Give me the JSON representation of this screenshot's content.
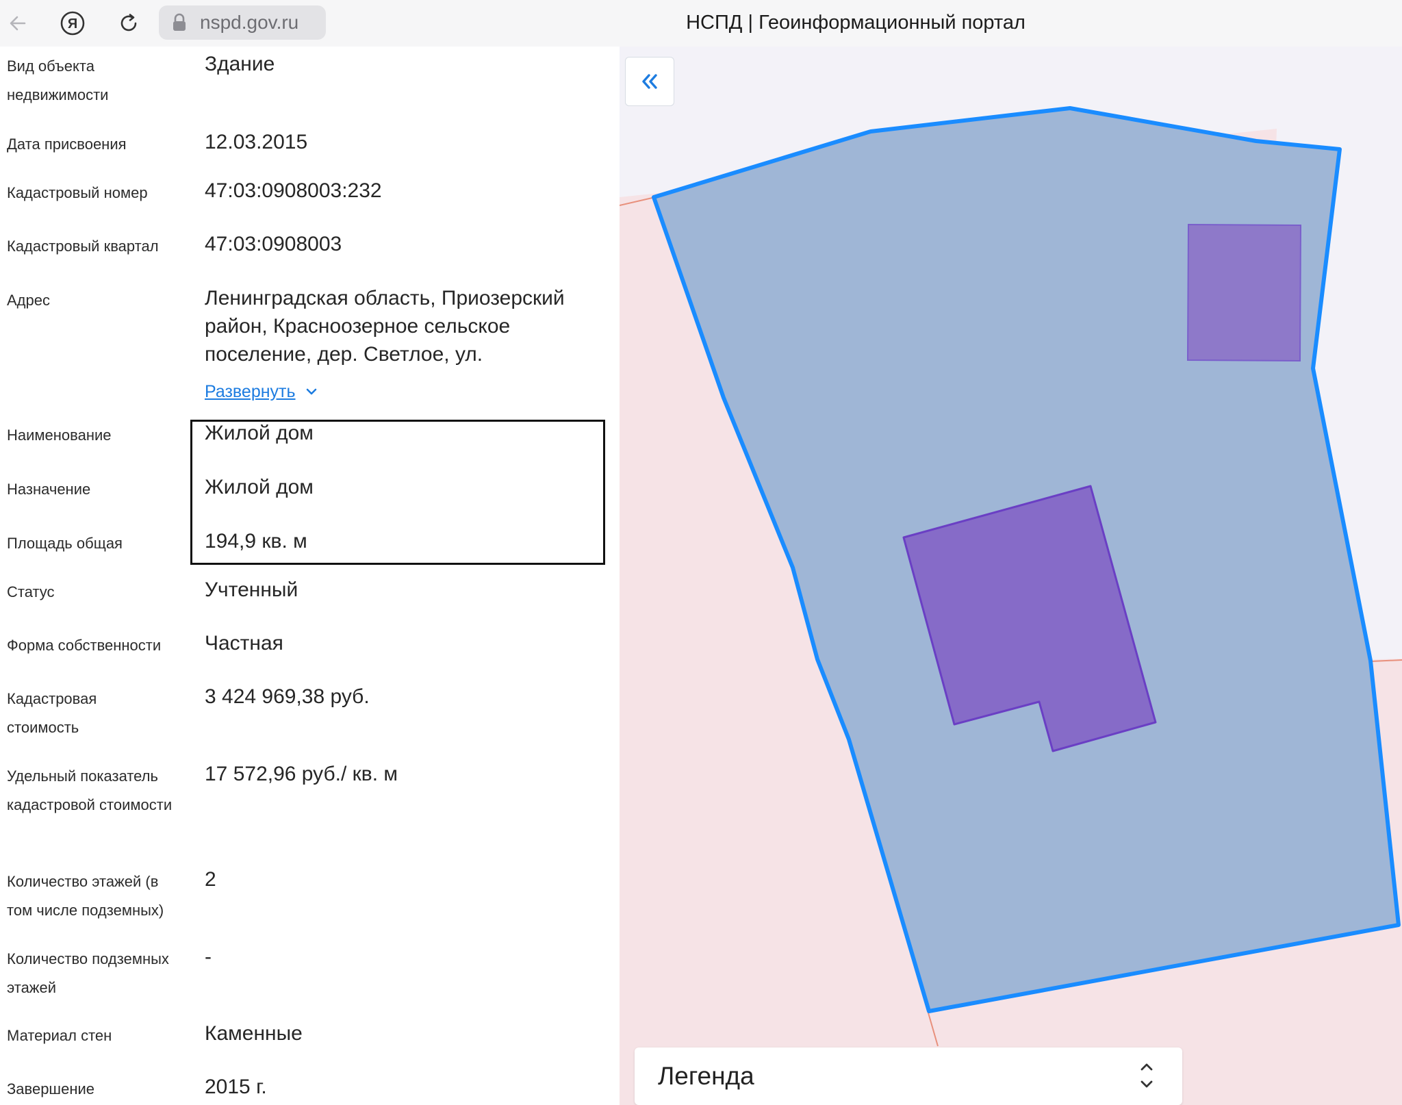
{
  "browser": {
    "url": "nspd.gov.ru",
    "title": "НСПД | Геоинформационный портал",
    "brand_glyph": "Я"
  },
  "properties": [
    {
      "label": "Вид объекта недвижимости",
      "value": "Здание"
    },
    {
      "label": "Дата присвоения",
      "value": "12.03.2015"
    },
    {
      "label": "Кадастровый номер",
      "value": "47:03:0908003:232"
    },
    {
      "label": "Кадастровый квартал",
      "value": "47:03:0908003"
    },
    {
      "label": "Адрес",
      "value": "Ленинградская область, Приозерский район, Красноозерное сельское поселение, дер. Светлое, ул."
    },
    {
      "label": "Наименование",
      "value": "Жилой дом"
    },
    {
      "label": "Назначение",
      "value": "Жилой дом"
    },
    {
      "label": "Площадь общая",
      "value": "194,9 кв. м"
    },
    {
      "label": "Статус",
      "value": "Учтенный"
    },
    {
      "label": "Форма собственности",
      "value": "Частная"
    },
    {
      "label": "Кадастровая стоимость",
      "value": "3 424 969,38 руб."
    },
    {
      "label": "Удельный показатель кадастровой стоимости",
      "value": "17 572,96 руб./ кв. м"
    },
    {
      "label": "Количество этажей (в том числе подземных)",
      "value": "2"
    },
    {
      "label": "Количество подземных этажей",
      "value": "-"
    },
    {
      "label": "Материал стен",
      "value": "Каменные"
    },
    {
      "label": "Завершение",
      "value": "2015 г."
    }
  ],
  "expand_link": "Развернуть",
  "map": {
    "legend_title": "Легенда",
    "colors": {
      "background": "#f6e3e6",
      "parcel_fill": "#9fb6d6",
      "parcel_stroke": "#1a8cff",
      "building_fill": "#866bc8",
      "building_stroke": "#6a3fc4",
      "boundary": "#e8907c"
    }
  },
  "icons": {
    "back": "back-arrow-icon",
    "reload": "reload-icon",
    "lock": "lock-icon",
    "collapse": "double-chevron-left-icon",
    "expand": "chevron-down-icon",
    "legend_toggle": "up-down-chevron-icon"
  }
}
